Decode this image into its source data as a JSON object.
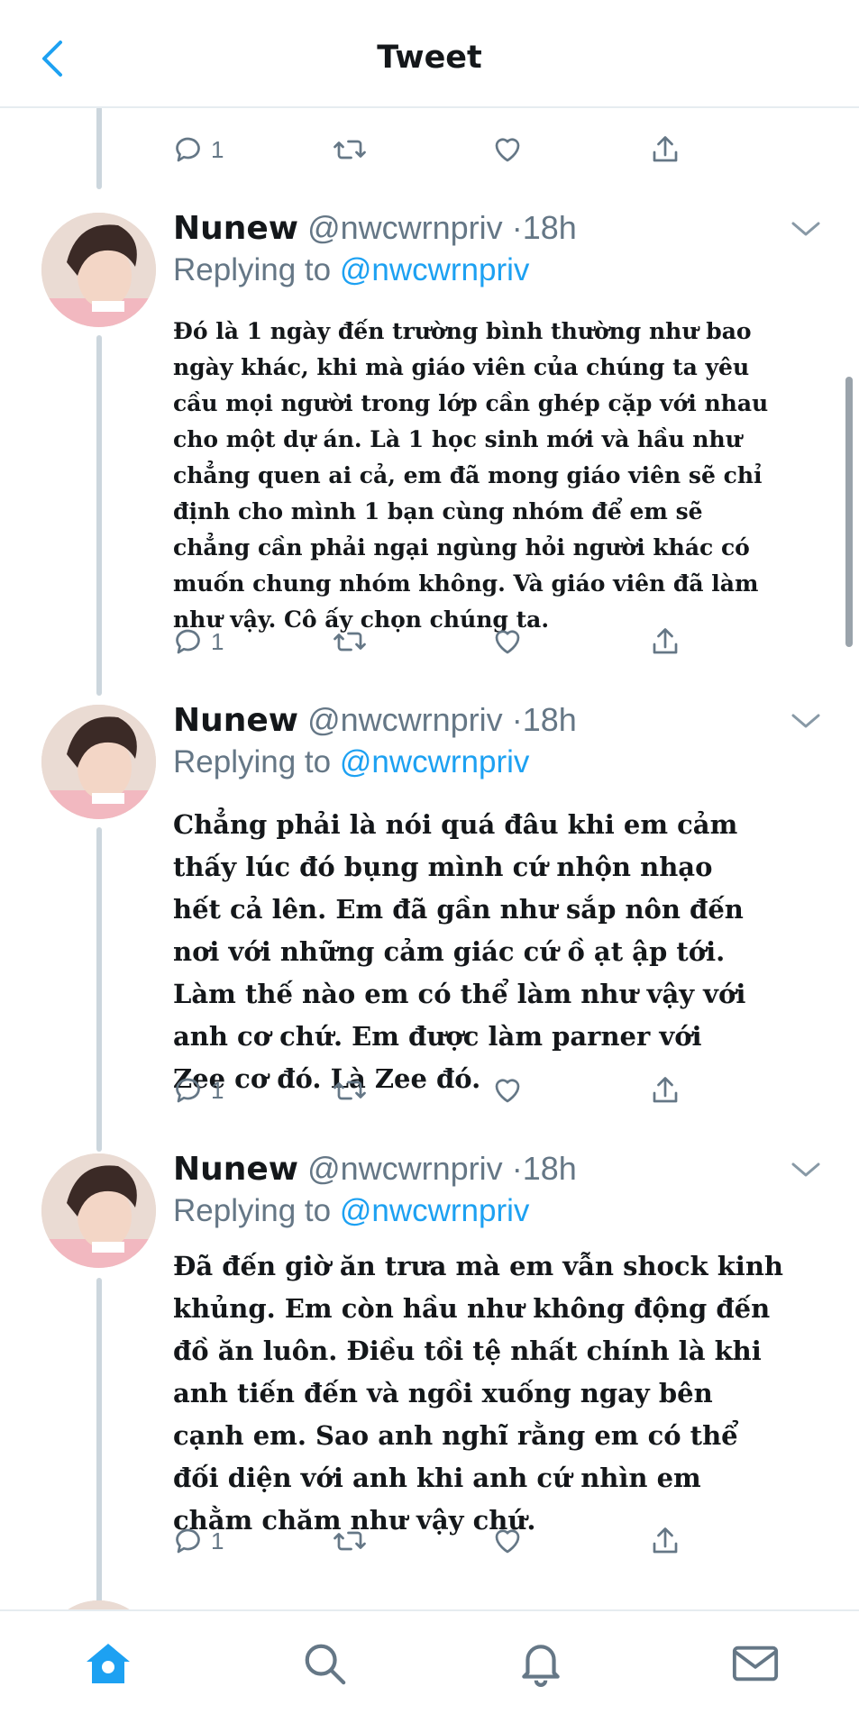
{
  "header": {
    "title": "Tweet"
  },
  "tweets": [
    {
      "author": "Nunew",
      "handle": "@nwcwrnpriv",
      "separator": "·",
      "time": "18h",
      "replying_prefix": "Replying to ",
      "replying_handle": "@nwcwrnpriv",
      "text": "Đó là 1 ngày đến trường bình thường như bao ngày khác, khi mà giáo viên của chúng ta yêu cầu mọi người trong lớp cần ghép cặp với nhau cho một dự án. Là 1 học sinh mới và hầu như chẳng quen ai cả, em đã mong giáo viên sẽ chỉ định cho mình 1 bạn cùng nhóm để em sẽ chẳng cần phải ngại ngùng hỏi người khác có muốn chung nhóm không. Và giáo viên đã làm như vậy. Cô ấy chọn chúng ta.",
      "reply_count": "1"
    },
    {
      "author": "Nunew",
      "handle": "@nwcwrnpriv",
      "separator": "·",
      "time": "18h",
      "replying_prefix": "Replying to ",
      "replying_handle": "@nwcwrnpriv",
      "text": "Chẳng phải là nói quá đâu khi em cảm thấy lúc đó bụng mình cứ nhộn nhạo hết cả lên. Em đã gần như sắp nôn đến nơi với những cảm giác cứ ồ ạt ập tới. Làm thế nào em có thể làm như vậy với anh cơ chứ. Em được làm parner với Zee cơ đó. Là Zee đó.",
      "reply_count": "1"
    },
    {
      "author": "Nunew",
      "handle": "@nwcwrnpriv",
      "separator": "·",
      "time": "18h",
      "replying_prefix": "Replying to ",
      "replying_handle": "@nwcwrnpriv",
      "text": "Đã đến giờ ăn trưa mà em vẫn shock kinh khủng. Em còn hầu như không động đến đồ ăn luôn. Điều tồi tệ nhất chính là khi anh tiến đến và ngồi xuống ngay bên cạnh em. Sao anh nghĩ rằng em có thể đối diện với anh khi anh cứ nhìn em chằm chăm như vậy chứ.",
      "reply_count": "1"
    }
  ],
  "top_partial": {
    "reply_count": "1"
  },
  "colors": {
    "accent": "#1da1f2",
    "secondary_text": "#657786",
    "divider": "#e6ecf0"
  },
  "icons": [
    "back-chevron-icon",
    "reply-icon",
    "retweet-icon",
    "like-icon",
    "share-icon",
    "caret-down-icon",
    "home-icon",
    "search-icon",
    "notifications-icon",
    "messages-icon"
  ]
}
